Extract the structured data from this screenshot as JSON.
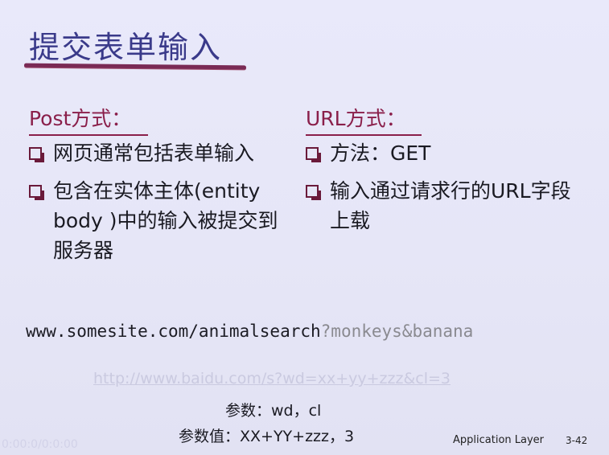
{
  "slide": {
    "title": "提交表单输入",
    "post_heading": "Post方式：",
    "url_heading": "URL方式：",
    "left_bullets": [
      {
        "text": "网页通常包括表单输入"
      },
      {
        "text": "包含在实体主体(entity body )中的输入被提交到服务器"
      }
    ],
    "right_bullets": [
      {
        "text": "方法：GET"
      },
      {
        "text": "输入通过请求行的URL字段上载"
      }
    ],
    "url_prefix": "www.somesite.com/animalsearch",
    "url_query": "?monkeys&banana",
    "faded_link": "http://www.baidu.com/s?wd=xx+yy+zzz&cl=3",
    "params_line": "参数：wd，cl",
    "values_line": "参数值：XX+YY+zzz，3",
    "footer_label": "Application Layer",
    "footer_page": "3-42",
    "watermark": "0:00:0/0:0:00"
  },
  "colors": {
    "title": "#3a3a8a",
    "heading": "#8a1f4a",
    "underline": "#7a2a55",
    "background": "#e6e6f7"
  },
  "icons": {
    "bullet": "hollow-square-bullet-icon"
  }
}
